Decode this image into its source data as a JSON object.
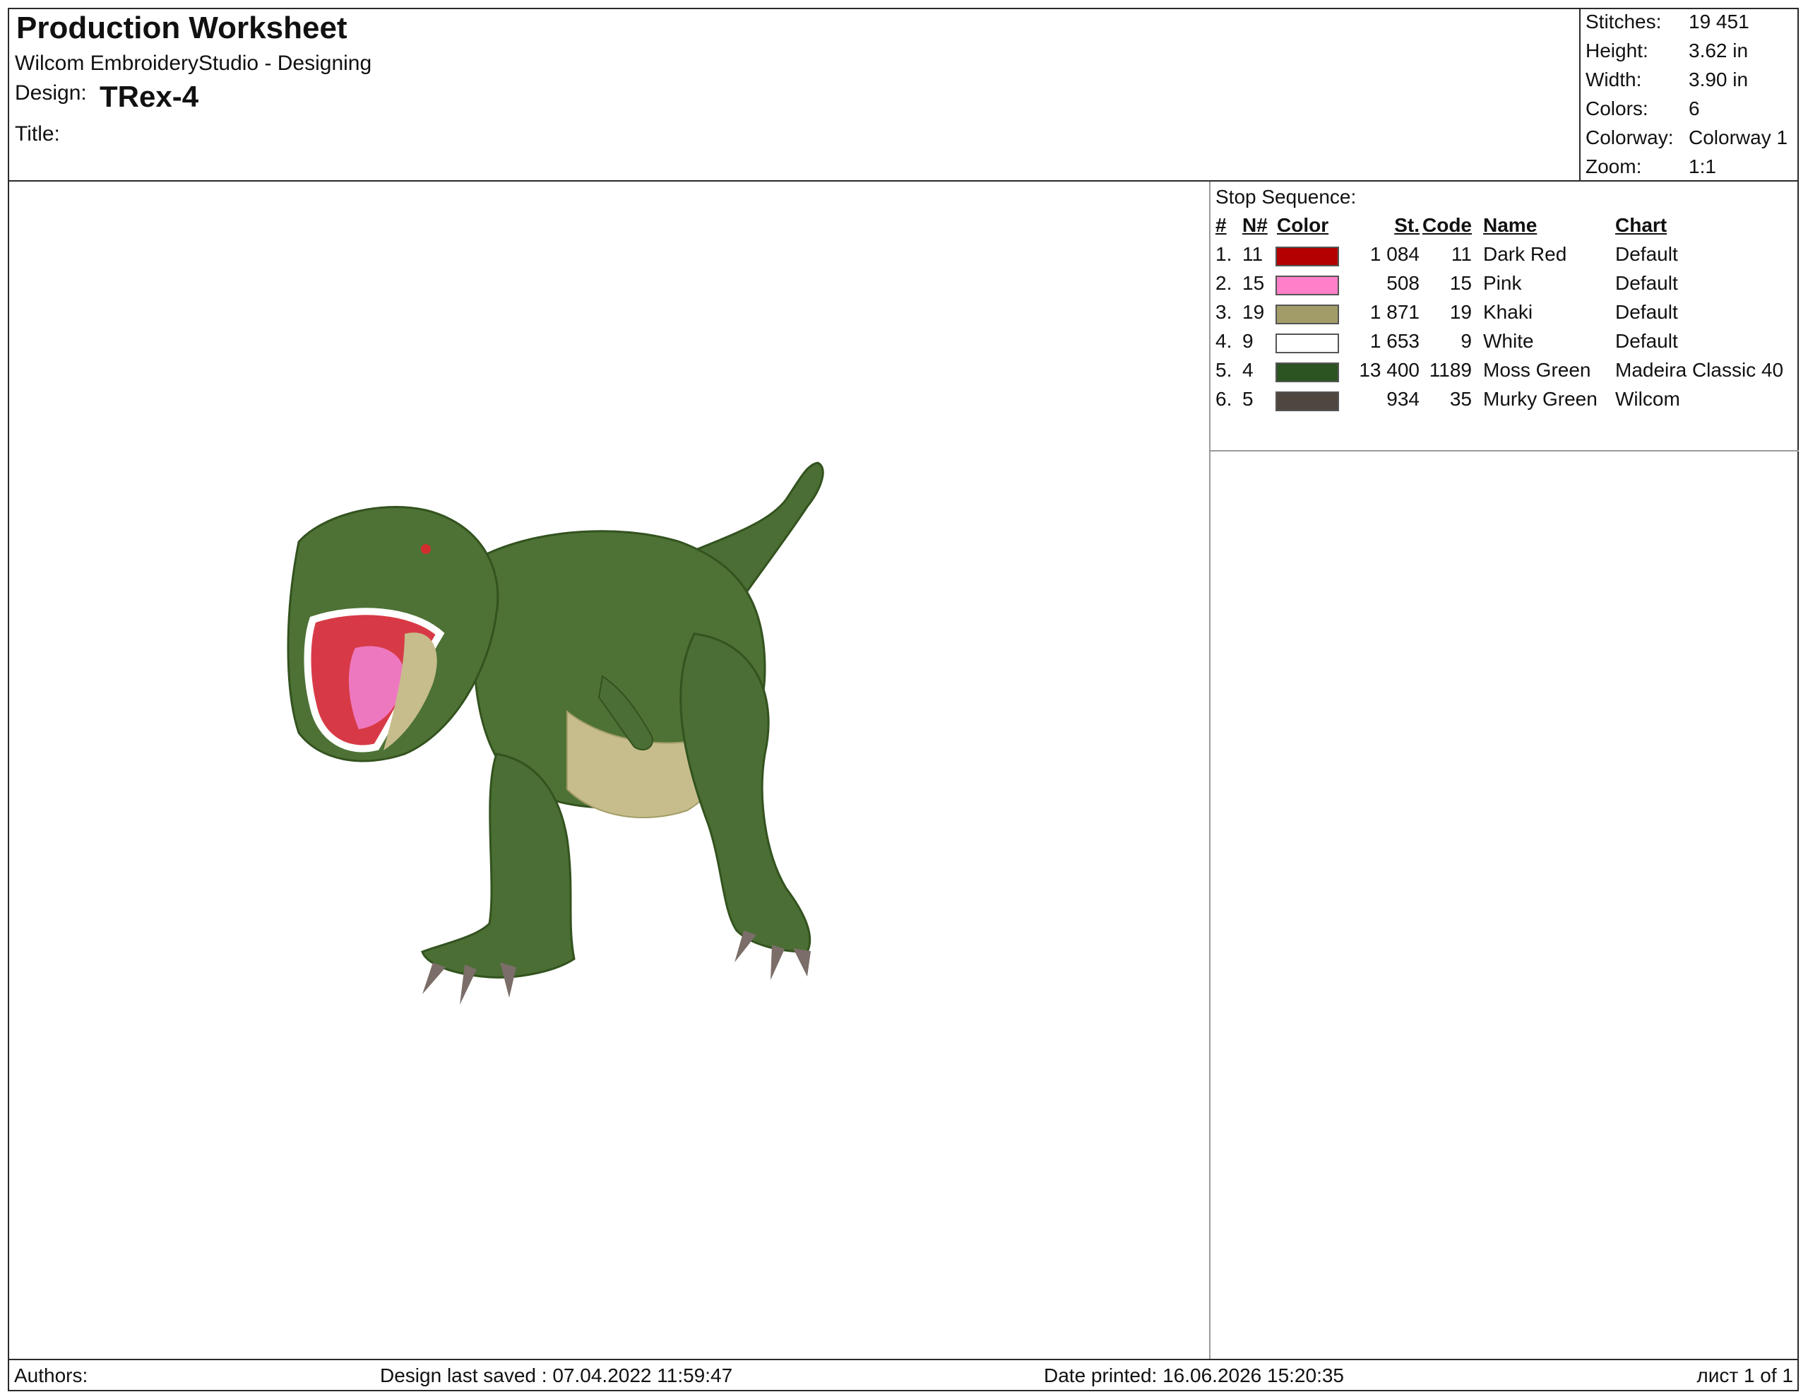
{
  "header": {
    "title": "Production Worksheet",
    "app": "Wilcom EmbroideryStudio - Designing",
    "design_label": "Design:",
    "design_name": "TRex-4",
    "title_label": "Title:"
  },
  "stats": [
    {
      "label": "Stitches:",
      "value": "19 451"
    },
    {
      "label": "Height:",
      "value": "3.62 in"
    },
    {
      "label": "Width:",
      "value": "3.90 in"
    },
    {
      "label": "Colors:",
      "value": "6"
    },
    {
      "label": "Colorway:",
      "value": "Colorway 1"
    },
    {
      "label": "Zoom:",
      "value": "1:1"
    }
  ],
  "stop_sequence": {
    "title": "Stop Sequence:",
    "headers": {
      "idx": "#",
      "n": "N#",
      "color": "Color",
      "st": "St.",
      "code": "Code",
      "name": "Name",
      "chart": "Chart"
    },
    "rows": [
      {
        "idx": "1.",
        "n": "11",
        "color_hex": "#b40000",
        "st": "1 084",
        "code": "11",
        "name": "Dark Red",
        "chart": "Default"
      },
      {
        "idx": "2.",
        "n": "15",
        "color_hex": "#ff80c8",
        "st": "508",
        "code": "15",
        "name": "Pink",
        "chart": "Default"
      },
      {
        "idx": "3.",
        "n": "19",
        "color_hex": "#a29d68",
        "st": "1 871",
        "code": "19",
        "name": "Khaki",
        "chart": "Default"
      },
      {
        "idx": "4.",
        "n": "9",
        "color_hex": "#ffffff",
        "st": "1 653",
        "code": "9",
        "name": "White",
        "chart": "Default"
      },
      {
        "idx": "5.",
        "n": "4",
        "color_hex": "#2b5422",
        "st": "13 400",
        "code": "1189",
        "name": "Moss Green",
        "chart": "Madeira Classic 40"
      },
      {
        "idx": "6.",
        "n": "5",
        "color_hex": "#4f463f",
        "st": "934",
        "code": "35",
        "name": "Murky Green",
        "chart": "Wilcom"
      }
    ]
  },
  "footer": {
    "authors": "Authors:",
    "saved": "Design last saved : 07.04.2022 11:59:47",
    "printed": "Date printed: 16.06.2026 15:20:35",
    "sheet": "лист 1 of 1"
  }
}
